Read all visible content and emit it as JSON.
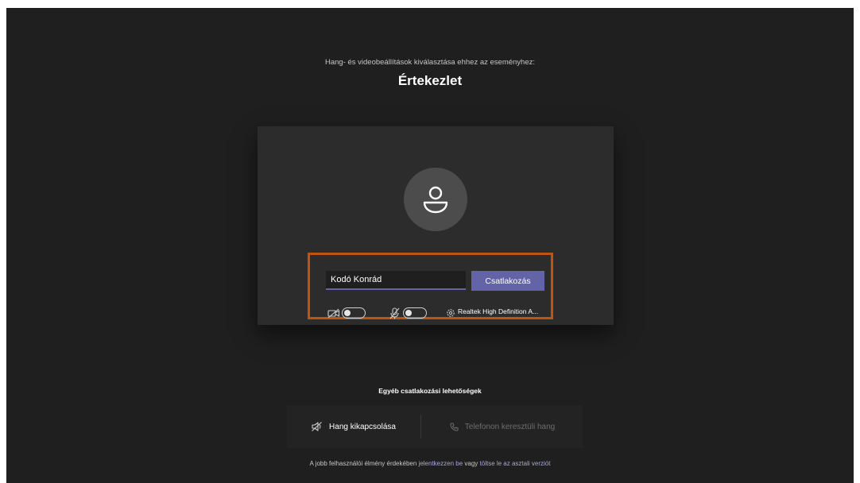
{
  "header": {
    "subtitle": "Hang- és videobeállítások kiválasztása ehhez az eseményhez:",
    "title": "Értekezlet"
  },
  "prejoin": {
    "name_value": "Kodó Konrád",
    "join_label": "Csatlakozás",
    "camera": {
      "icon": "video-off-icon",
      "enabled": false
    },
    "microphone": {
      "icon": "mic-off-icon",
      "enabled": false
    },
    "device": {
      "icon": "gear-icon",
      "label": "Realtek High Definition A..."
    },
    "highlight_color": "#c0540e",
    "accent_color": "#6264a7"
  },
  "other_options": {
    "heading": "Egyéb csatlakozási lehetőségek",
    "audio_off": {
      "icon": "speaker-off-icon",
      "label": "Hang kikapcsolása"
    },
    "phone_audio": {
      "icon": "phone-icon",
      "label": "Telefonon keresztüli hang"
    }
  },
  "footer": {
    "prefix": "A jobb felhasználói élmény érdekében",
    "link_signin": "jelentkezzen be",
    "middle": "vagy",
    "link_download": "töltse le az asztali verziót"
  }
}
